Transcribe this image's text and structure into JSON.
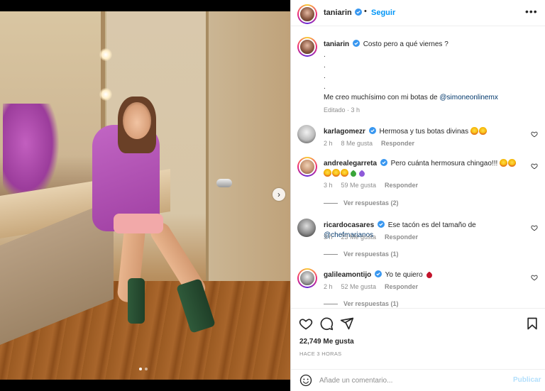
{
  "post": {
    "author": "taniarin",
    "follow_label": "Seguir",
    "separator": "•",
    "more_label": "•••",
    "carousel": {
      "current_slide": 1,
      "total_slides": 2,
      "next_label": "›"
    }
  },
  "caption": {
    "username": "taniarin",
    "line1": "Costo pero a qué viernes ?",
    "dot1": ".",
    "dot2": ".",
    "dot3": ".",
    "dot4": ".",
    "line6_prefix": "Me creo muchísimo con mi botas de ",
    "line6_mention": "@simoneonlinemx",
    "meta": "Editado · 3 h"
  },
  "comments": [
    {
      "username": "karlagomezr",
      "text": "Hermosa y tus botas divinas",
      "time": "2 h",
      "likes": "8 Me gusta",
      "reply_label": "Responder",
      "replies": ""
    },
    {
      "username": "andrealegarreta",
      "text": "Pero cuánta hermosura chingao!!!",
      "time": "3 h",
      "likes": "59 Me gusta",
      "reply_label": "Responder",
      "replies": "Ver respuestas (2)"
    },
    {
      "username": "ricardocasares",
      "text": "Ese tacón es del tamaño de ",
      "mention": "@chefmarianos",
      "time": "3 h",
      "likes": "23 Me gusta",
      "reply_label": "Responder",
      "replies": "Ver respuestas (1)"
    },
    {
      "username": "galileamontijo",
      "text": "Yo te quiero",
      "time": "2 h",
      "likes": "52 Me gusta",
      "reply_label": "Responder",
      "replies": "Ver respuestas (1)"
    }
  ],
  "actions": {
    "likes": "22,749 Me gusta",
    "posted": "HACE 3 HORAS"
  },
  "compose": {
    "placeholder": "Añade un comentario...",
    "publish_label": "Publicar"
  },
  "colors": {
    "accent": "#0095f6",
    "verified": "#3897f0",
    "text": "#262626",
    "muted": "#8e8e8e"
  },
  "icons": [
    "verified-icon",
    "more-icon",
    "chevron-right-icon",
    "heart-icon",
    "comment-icon",
    "share-icon",
    "bookmark-icon",
    "emoji-icon"
  ]
}
